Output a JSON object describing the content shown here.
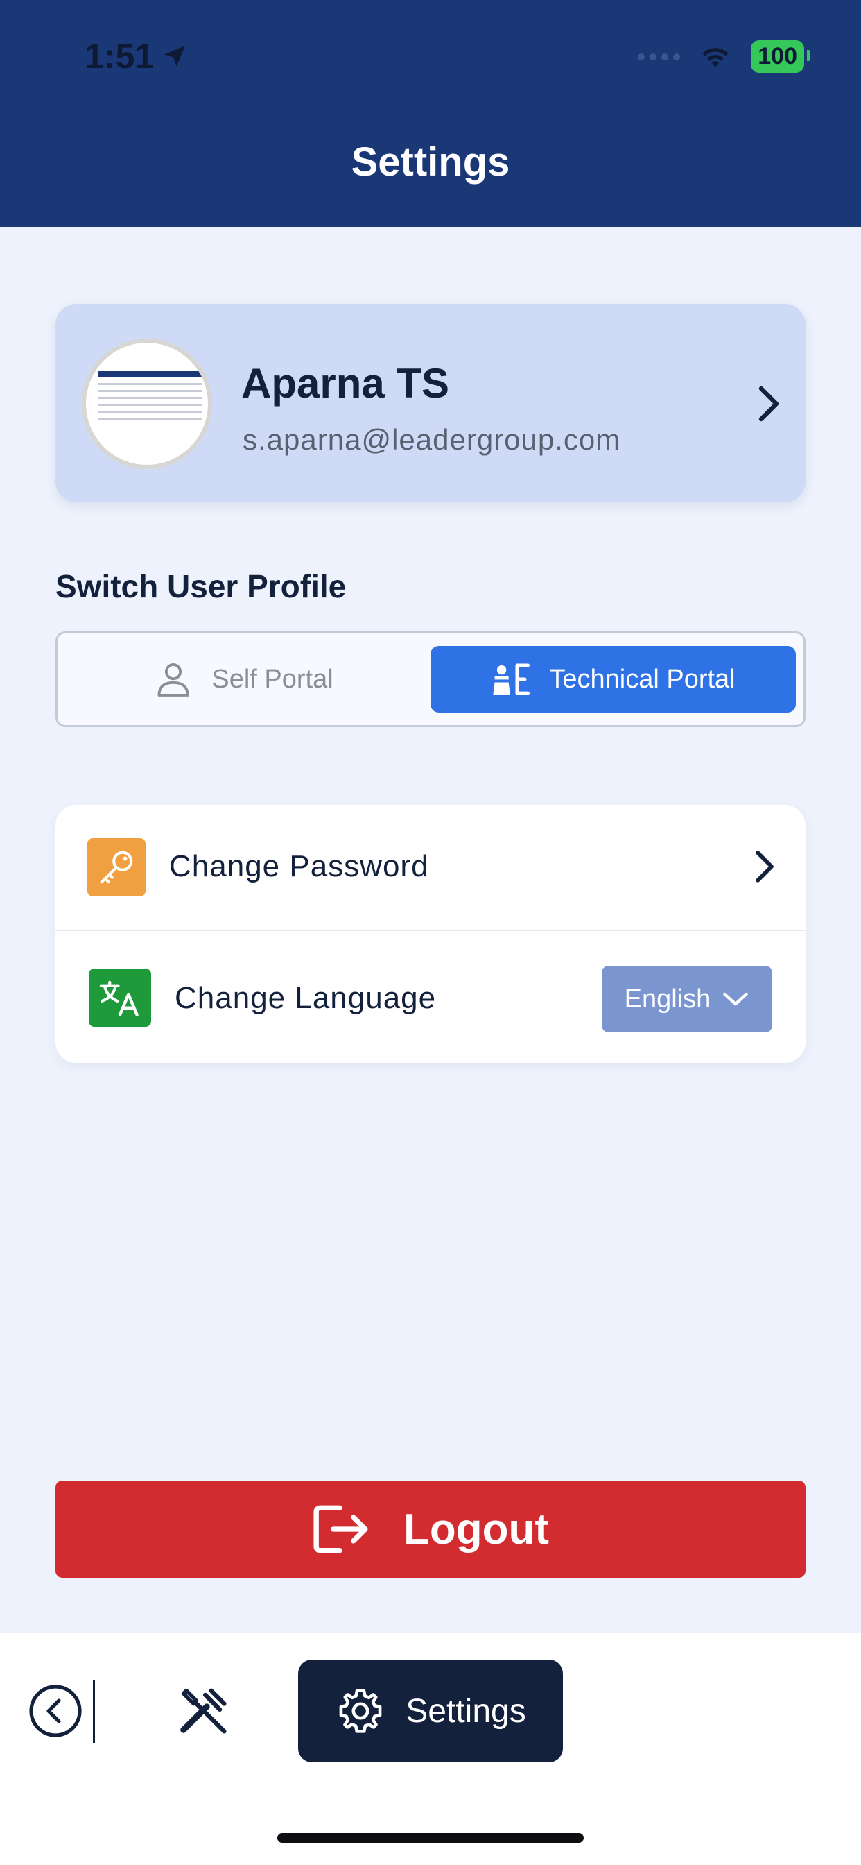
{
  "status_bar": {
    "time": "1:51",
    "battery": "100",
    "icons": [
      "location-arrow-icon",
      "signal-dots-icon",
      "wifi-icon",
      "battery-icon"
    ]
  },
  "header": {
    "title": "Settings"
  },
  "profile": {
    "name": "Aparna TS",
    "email": "s.aparna@leadergroup.com",
    "icons": [
      "avatar",
      "chevron-right-icon"
    ]
  },
  "switch_profile": {
    "label": "Switch User Profile",
    "options": [
      {
        "label": "Self Portal",
        "icon": "person-icon",
        "selected": false
      },
      {
        "label": "Technical Portal",
        "icon": "technician-icon",
        "selected": true
      }
    ]
  },
  "options": {
    "change_password": {
      "label": "Change Password",
      "icon": "key-icon"
    },
    "change_language": {
      "label": "Change Language",
      "icon": "translate-icon",
      "selected_value": "English"
    }
  },
  "logout": {
    "label": "Logout",
    "icon": "logout-icon"
  },
  "bottom_nav": {
    "items": [
      {
        "icon": "back-circle-icon"
      },
      {
        "icon": "tools-icon"
      },
      {
        "label": "Settings",
        "icon": "gear-icon",
        "active": true
      }
    ]
  },
  "colors": {
    "header_bg": "#1A3776",
    "page_bg": "#EEF2FC",
    "profile_card_bg": "#CFDBF6",
    "selected_segment": "#2F72E6",
    "key_tile": "#F0A040",
    "translate_tile": "#1E9A3A",
    "language_select": "#7B95D0",
    "logout": "#D32C30",
    "nav_active": "#14213D"
  }
}
